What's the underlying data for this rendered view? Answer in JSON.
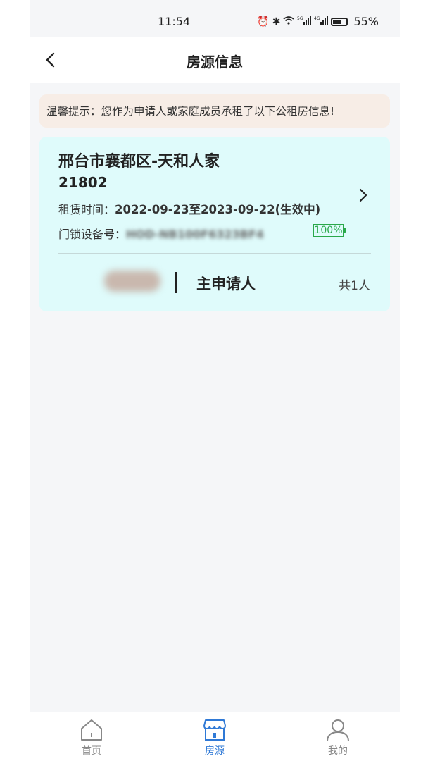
{
  "status_bar": {
    "time": "11:54",
    "battery": "55%",
    "icons": [
      "alarm-icon",
      "bluetooth-icon",
      "wifi-icon",
      "5g-signal-icon",
      "4g-signal-icon",
      "battery-icon"
    ]
  },
  "header": {
    "title": "房源信息"
  },
  "tip": {
    "text": "温馨提示：您作为申请人或家庭成员承租了以下公租房信息!"
  },
  "property": {
    "name": "邢台市襄都区-天和人家",
    "room": "21802",
    "lease_label": "租赁时间：",
    "lease_value": "2022-09-23至2023-09-22(生效中)",
    "lock_label": "门锁设备号：",
    "lock_id": "HOD-NB100F6323BF4",
    "lock_battery": "100%",
    "role": "主申请人",
    "count": "共1人"
  },
  "tabbar": {
    "items": [
      {
        "label": "首页",
        "icon": "home-icon"
      },
      {
        "label": "房源",
        "icon": "store-icon",
        "active": true
      },
      {
        "label": "我的",
        "icon": "user-icon"
      }
    ]
  },
  "colors": {
    "accent": "#2f79d6",
    "card_bg": "#dffbfb",
    "tip_bg": "#f7ede6",
    "lock_battery": "#2aa84a"
  }
}
